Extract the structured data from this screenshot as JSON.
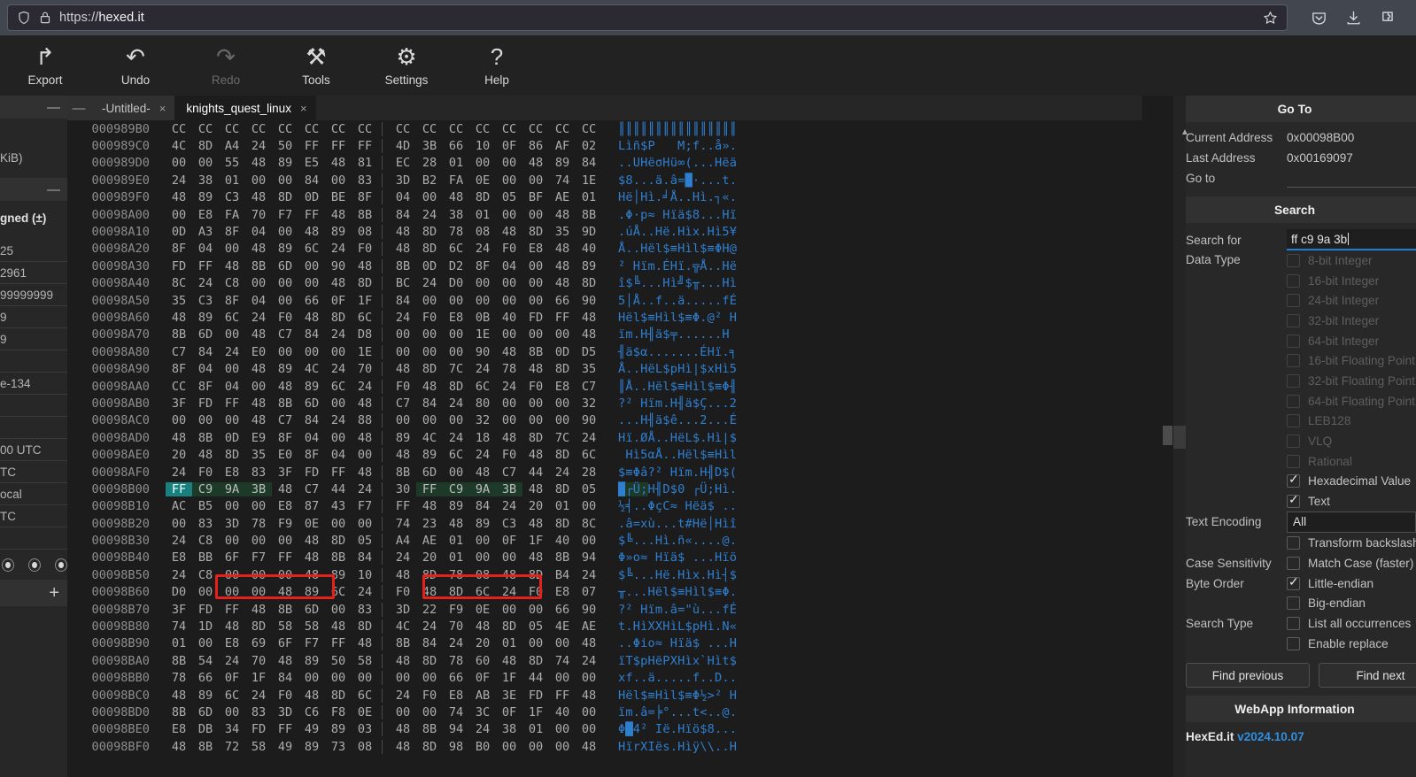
{
  "browser": {
    "url_scheme": "https://",
    "url_host": "hexed.it",
    "shield_icon": "shield-icon",
    "lock_icon": "lock-icon",
    "star_icon": "bookmark-star-icon",
    "pocket_icon": "pocket-icon",
    "download_icon": "download-icon",
    "extensions_icon": "extensions-icon"
  },
  "toolbar": {
    "items": [
      {
        "label": "Export",
        "icon": "export-icon",
        "glyph": "↱",
        "disabled": false
      },
      {
        "label": "Undo",
        "icon": "undo-icon",
        "glyph": "↶",
        "disabled": false
      },
      {
        "label": "Redo",
        "icon": "redo-icon",
        "glyph": "↷",
        "disabled": true
      },
      {
        "label": "Tools",
        "icon": "tools-icon",
        "glyph": "⚒",
        "disabled": false
      },
      {
        "label": "Settings",
        "icon": "gear-icon",
        "glyph": "⚙",
        "disabled": false
      },
      {
        "label": "Help",
        "icon": "question-icon",
        "glyph": "?",
        "disabled": false
      }
    ]
  },
  "tabs": {
    "collapse_glyph": "—",
    "items": [
      {
        "label": "-Untitled-",
        "active": false,
        "close": "×"
      },
      {
        "label": "knights_quest_linux",
        "active": true,
        "close": "×"
      }
    ]
  },
  "left_panel": {
    "collapse_glyph": "—",
    "clipped_lines": [
      "KiB)"
    ],
    "section_collapse_glyph": "—",
    "header_fragment": "gned (±)",
    "rows": [
      "25",
      "2961",
      "99999999",
      "9",
      "9",
      "",
      "e-134",
      "",
      "",
      "00 UTC",
      "TC",
      "ocal",
      "TC",
      ""
    ],
    "radio_count": 3,
    "plus_glyph": "+"
  },
  "hex": {
    "row_addr_start": "000989B0",
    "rows": [
      {
        "addr": "000989B0",
        "bytes": [
          "CC",
          "CC",
          "CC",
          "CC",
          "CC",
          "CC",
          "CC",
          "CC",
          "CC",
          "CC",
          "CC",
          "CC",
          "CC",
          "CC",
          "CC",
          "CC"
        ],
        "ascii": "║║║║║║║║║║║║║║║║"
      },
      {
        "addr": "000989C0",
        "bytes": [
          "4C",
          "8D",
          "A4",
          "24",
          "50",
          "FF",
          "FF",
          "FF",
          "4D",
          "3B",
          "66",
          "10",
          "0F",
          "86",
          "AF",
          "02"
        ],
        "ascii": "Lìñ$P   M;f..å»."
      },
      {
        "addr": "000989D0",
        "bytes": [
          "00",
          "00",
          "55",
          "48",
          "89",
          "E5",
          "48",
          "81",
          "EC",
          "28",
          "01",
          "00",
          "00",
          "48",
          "89",
          "84"
        ],
        "ascii": "..UHëσHü∞(...Hëä"
      },
      {
        "addr": "000989E0",
        "bytes": [
          "24",
          "38",
          "01",
          "00",
          "00",
          "84",
          "00",
          "83",
          "3D",
          "B2",
          "FA",
          "0E",
          "00",
          "00",
          "74",
          "1E"
        ],
        "ascii": "$8...ä.â=█·...t."
      },
      {
        "addr": "000989F0",
        "bytes": [
          "48",
          "89",
          "C3",
          "48",
          "8D",
          "0D",
          "BE",
          "8F",
          "04",
          "00",
          "48",
          "8D",
          "05",
          "BF",
          "AE",
          "01"
        ],
        "ascii": "Hë│Hì.╛Å..Hì.┐«."
      },
      {
        "addr": "00098A00",
        "bytes": [
          "00",
          "E8",
          "FA",
          "70",
          "F7",
          "FF",
          "48",
          "8B",
          "84",
          "24",
          "38",
          "01",
          "00",
          "00",
          "48",
          "8B"
        ],
        "ascii": ".Φ·p≈ Hïä$8...Hï"
      },
      {
        "addr": "00098A10",
        "bytes": [
          "0D",
          "A3",
          "8F",
          "04",
          "00",
          "48",
          "89",
          "08",
          "48",
          "8D",
          "78",
          "08",
          "48",
          "8D",
          "35",
          "9D"
        ],
        "ascii": ".úÅ..Hë.Hìx.Hì5¥"
      },
      {
        "addr": "00098A20",
        "bytes": [
          "8F",
          "04",
          "00",
          "48",
          "89",
          "6C",
          "24",
          "F0",
          "48",
          "8D",
          "6C",
          "24",
          "F0",
          "E8",
          "48",
          "40"
        ],
        "ascii": "Å..Hël$≡Hìl$≡ΦH@"
      },
      {
        "addr": "00098A30",
        "bytes": [
          "FD",
          "FF",
          "48",
          "8B",
          "6D",
          "00",
          "90",
          "48",
          "8B",
          "0D",
          "D2",
          "8F",
          "04",
          "00",
          "48",
          "89"
        ],
        "ascii": "² Hïm.ÉHï.╦Å..Hë"
      },
      {
        "addr": "00098A40",
        "bytes": [
          "8C",
          "24",
          "C8",
          "00",
          "00",
          "00",
          "48",
          "8D",
          "BC",
          "24",
          "D0",
          "00",
          "00",
          "00",
          "48",
          "8D"
        ],
        "ascii": "î$╚...Hì╝$╥...Hì"
      },
      {
        "addr": "00098A50",
        "bytes": [
          "35",
          "C3",
          "8F",
          "04",
          "00",
          "66",
          "0F",
          "1F",
          "84",
          "00",
          "00",
          "00",
          "00",
          "00",
          "66",
          "90"
        ],
        "ascii": "5│Å..f..ä.....fÉ"
      },
      {
        "addr": "00098A60",
        "bytes": [
          "48",
          "89",
          "6C",
          "24",
          "F0",
          "48",
          "8D",
          "6C",
          "24",
          "F0",
          "E8",
          "0B",
          "40",
          "FD",
          "FF",
          "48"
        ],
        "ascii": "Hël$≡Hìl$≡Φ.@² H"
      },
      {
        "addr": "00098A70",
        "bytes": [
          "8B",
          "6D",
          "00",
          "48",
          "C7",
          "84",
          "24",
          "D8",
          "00",
          "00",
          "00",
          "1E",
          "00",
          "00",
          "00",
          "48"
        ],
        "ascii": "ïm.H╢ä$╤......H"
      },
      {
        "addr": "00098A80",
        "bytes": [
          "C7",
          "84",
          "24",
          "E0",
          "00",
          "00",
          "00",
          "1E",
          "00",
          "00",
          "00",
          "90",
          "48",
          "8B",
          "0D",
          "D5"
        ],
        "ascii": "╢ä$α.......ÉHï.╕"
      },
      {
        "addr": "00098A90",
        "bytes": [
          "8F",
          "04",
          "00",
          "48",
          "89",
          "4C",
          "24",
          "70",
          "48",
          "8D",
          "7C",
          "24",
          "78",
          "48",
          "8D",
          "35"
        ],
        "ascii": "Å..HëL$pHì|$xHì5"
      },
      {
        "addr": "00098AA0",
        "bytes": [
          "CC",
          "8F",
          "04",
          "00",
          "48",
          "89",
          "6C",
          "24",
          "F0",
          "48",
          "8D",
          "6C",
          "24",
          "F0",
          "E8",
          "C7"
        ],
        "ascii": "║Å..Hël$≡Hìl$≡Φ╢"
      },
      {
        "addr": "00098AB0",
        "bytes": [
          "3F",
          "FD",
          "FF",
          "48",
          "8B",
          "6D",
          "00",
          "48",
          "C7",
          "84",
          "24",
          "80",
          "00",
          "00",
          "00",
          "32"
        ],
        "ascii": "?² Hïm.H╢ä$Ç...2"
      },
      {
        "addr": "00098AC0",
        "bytes": [
          "00",
          "00",
          "00",
          "48",
          "C7",
          "84",
          "24",
          "88",
          "00",
          "00",
          "00",
          "32",
          "00",
          "00",
          "00",
          "90"
        ],
        "ascii": "...H╢ä$ê...2...É"
      },
      {
        "addr": "00098AD0",
        "bytes": [
          "48",
          "8B",
          "0D",
          "E9",
          "8F",
          "04",
          "00",
          "48",
          "89",
          "4C",
          "24",
          "18",
          "48",
          "8D",
          "7C",
          "24"
        ],
        "ascii": "Hï.ØÅ..HëL$.Hì|$"
      },
      {
        "addr": "00098AE0",
        "bytes": [
          "20",
          "48",
          "8D",
          "35",
          "E0",
          "8F",
          "04",
          "00",
          "48",
          "89",
          "6C",
          "24",
          "F0",
          "48",
          "8D",
          "6C"
        ],
        "ascii": " Hì5αÅ..Hël$≡Hìl"
      },
      {
        "addr": "00098AF0",
        "bytes": [
          "24",
          "F0",
          "E8",
          "83",
          "3F",
          "FD",
          "FF",
          "48",
          "8B",
          "6D",
          "00",
          "48",
          "C7",
          "44",
          "24",
          "28"
        ],
        "ascii": "$≡Φâ?² Hïm.H╢D$("
      },
      {
        "addr": "00098B00",
        "bytes": [
          "FF",
          "C9",
          "9A",
          "3B",
          "48",
          "C7",
          "44",
          "24",
          "30",
          "FF",
          "C9",
          "9A",
          "3B",
          "48",
          "8D",
          "05"
        ],
        "ascii": "█┌Ü;H╢D$0 ┌Ü;Hì.",
        "cursor_index": 0,
        "match_indices": [
          1,
          2,
          3
        ],
        "match2_indices": [
          9,
          10,
          11,
          12
        ]
      },
      {
        "addr": "00098B10",
        "bytes": [
          "AC",
          "B5",
          "00",
          "00",
          "E8",
          "87",
          "43",
          "F7",
          "FF",
          "48",
          "89",
          "84",
          "24",
          "20",
          "01",
          "00"
        ],
        "ascii": "½╡..ΦçC≈ Hëä$ .."
      },
      {
        "addr": "00098B20",
        "bytes": [
          "00",
          "83",
          "3D",
          "78",
          "F9",
          "0E",
          "00",
          "00",
          "74",
          "23",
          "48",
          "89",
          "C3",
          "48",
          "8D",
          "8C"
        ],
        "ascii": ".â=xù...t#Hë│Hìî"
      },
      {
        "addr": "00098B30",
        "bytes": [
          "24",
          "C8",
          "00",
          "00",
          "00",
          "48",
          "8D",
          "05",
          "A4",
          "AE",
          "01",
          "00",
          "0F",
          "1F",
          "40",
          "00"
        ],
        "ascii": "$╚...Hì.ñ«....@."
      },
      {
        "addr": "00098B40",
        "bytes": [
          "E8",
          "BB",
          "6F",
          "F7",
          "FF",
          "48",
          "8B",
          "84",
          "24",
          "20",
          "01",
          "00",
          "00",
          "48",
          "8B",
          "94"
        ],
        "ascii": "Φ»o≈ Hïä$ ...Hïö"
      },
      {
        "addr": "00098B50",
        "bytes": [
          "24",
          "C8",
          "00",
          "00",
          "00",
          "48",
          "89",
          "10",
          "48",
          "8D",
          "78",
          "08",
          "48",
          "8D",
          "B4",
          "24"
        ],
        "ascii": "$╚...Hë.Hìx.Hì┤$"
      },
      {
        "addr": "00098B60",
        "bytes": [
          "D0",
          "00",
          "00",
          "00",
          "48",
          "89",
          "6C",
          "24",
          "F0",
          "48",
          "8D",
          "6C",
          "24",
          "F0",
          "E8",
          "07"
        ],
        "ascii": "╥...Hël$≡Hìl$≡Φ."
      },
      {
        "addr": "00098B70",
        "bytes": [
          "3F",
          "FD",
          "FF",
          "48",
          "8B",
          "6D",
          "00",
          "83",
          "3D",
          "22",
          "F9",
          "0E",
          "00",
          "00",
          "66",
          "90"
        ],
        "ascii": "?² Hïm.â=\"ù...fÉ"
      },
      {
        "addr": "00098B80",
        "bytes": [
          "74",
          "1D",
          "48",
          "8D",
          "58",
          "58",
          "48",
          "8D",
          "4C",
          "24",
          "70",
          "48",
          "8D",
          "05",
          "4E",
          "AE"
        ],
        "ascii": "t.HìXXHìL$pHì.N«"
      },
      {
        "addr": "00098B90",
        "bytes": [
          "01",
          "00",
          "E8",
          "69",
          "6F",
          "F7",
          "FF",
          "48",
          "8B",
          "84",
          "24",
          "20",
          "01",
          "00",
          "00",
          "48"
        ],
        "ascii": "..Φio≈ Hïä$ ...H"
      },
      {
        "addr": "00098BA0",
        "bytes": [
          "8B",
          "54",
          "24",
          "70",
          "48",
          "89",
          "50",
          "58",
          "48",
          "8D",
          "78",
          "60",
          "48",
          "8D",
          "74",
          "24"
        ],
        "ascii": "ïT$pHëPXHìx`Hìt$"
      },
      {
        "addr": "00098BB0",
        "bytes": [
          "78",
          "66",
          "0F",
          "1F",
          "84",
          "00",
          "00",
          "00",
          "00",
          "00",
          "66",
          "0F",
          "1F",
          "44",
          "00",
          "00"
        ],
        "ascii": "xf..ä.....f..D.."
      },
      {
        "addr": "00098BC0",
        "bytes": [
          "48",
          "89",
          "6C",
          "24",
          "F0",
          "48",
          "8D",
          "6C",
          "24",
          "F0",
          "E8",
          "AB",
          "3E",
          "FD",
          "FF",
          "48"
        ],
        "ascii": "Hël$≡Hìl$≡Φ½>² H"
      },
      {
        "addr": "00098BD0",
        "bytes": [
          "8B",
          "6D",
          "00",
          "83",
          "3D",
          "C6",
          "F8",
          "0E",
          "00",
          "00",
          "74",
          "3C",
          "0F",
          "1F",
          "40",
          "00"
        ],
        "ascii": "ïm.â=╞°...t<..@."
      },
      {
        "addr": "00098BE0",
        "bytes": [
          "E8",
          "DB",
          "34",
          "FD",
          "FF",
          "49",
          "89",
          "03",
          "48",
          "8B",
          "94",
          "24",
          "38",
          "01",
          "00",
          "00"
        ],
        "ascii": "Φ█4² Ië.Hïö$8...",
        "ascii_cursor_at": 1
      },
      {
        "addr": "00098BF0",
        "bytes": [
          "48",
          "8B",
          "72",
          "58",
          "49",
          "89",
          "73",
          "08",
          "48",
          "8D",
          "98",
          "B0",
          "00",
          "00",
          "00",
          "48"
        ],
        "ascii": "HïrXIës.Hìÿ\\\\..H"
      }
    ]
  },
  "sidebar": {
    "goto": {
      "title": "Go To",
      "current_address_label": "Current Address",
      "current_address_value": "0x00098B00",
      "last_address_label": "Last Address",
      "last_address_value": "0x00169097",
      "goto_label": "Go to",
      "goto_value": ""
    },
    "search": {
      "title": "Search",
      "search_for_label": "Search for",
      "search_for_value": "ff c9 9a 3b",
      "data_type_label": "Data Type",
      "data_types": [
        {
          "label": "8-bit Integer",
          "checked": false,
          "enabled": false
        },
        {
          "label": "16-bit Integer",
          "checked": false,
          "enabled": false
        },
        {
          "label": "24-bit Integer",
          "checked": false,
          "enabled": false
        },
        {
          "label": "32-bit Integer",
          "checked": false,
          "enabled": false
        },
        {
          "label": "64-bit Integer",
          "checked": false,
          "enabled": false
        },
        {
          "label": "16-bit Floating Point",
          "checked": false,
          "enabled": false
        },
        {
          "label": "32-bit Floating Point",
          "checked": false,
          "enabled": false
        },
        {
          "label": "64-bit Floating Point",
          "checked": false,
          "enabled": false
        },
        {
          "label": "LEB128",
          "checked": false,
          "enabled": false
        },
        {
          "label": "VLQ",
          "checked": false,
          "enabled": false
        },
        {
          "label": "Rational",
          "checked": false,
          "enabled": false
        },
        {
          "label": "Hexadecimal Value",
          "checked": true,
          "enabled": true
        },
        {
          "label": "Text",
          "checked": true,
          "enabled": true
        }
      ],
      "text_encoding_label": "Text Encoding",
      "text_encoding_value": "All",
      "transform_label": "Transform backslash escapes",
      "transform_checked": false,
      "case_label": "Case Sensitivity",
      "match_case_label": "Match Case (faster)",
      "match_case_checked": false,
      "byte_order_label": "Byte Order",
      "little_endian_label": "Little-endian",
      "little_endian_checked": true,
      "big_endian_label": "Big-endian",
      "big_endian_checked": false,
      "search_type_label": "Search Type",
      "list_all_label": "List all occurrences",
      "list_all_checked": false,
      "enable_replace_label": "Enable replace",
      "enable_replace_checked": false,
      "find_previous_label": "Find previous",
      "find_next_label": "Find next"
    },
    "webapp": {
      "title": "WebApp Information",
      "name": "HexEd.it",
      "version": "v2024.10.07"
    }
  },
  "colors": {
    "accent_blue": "#1f7fd4",
    "annotation_red": "#e8201c",
    "cursor_teal": "#18807e",
    "match_green": "#1d3a28",
    "ascii_blue": "#2f7fd0"
  }
}
